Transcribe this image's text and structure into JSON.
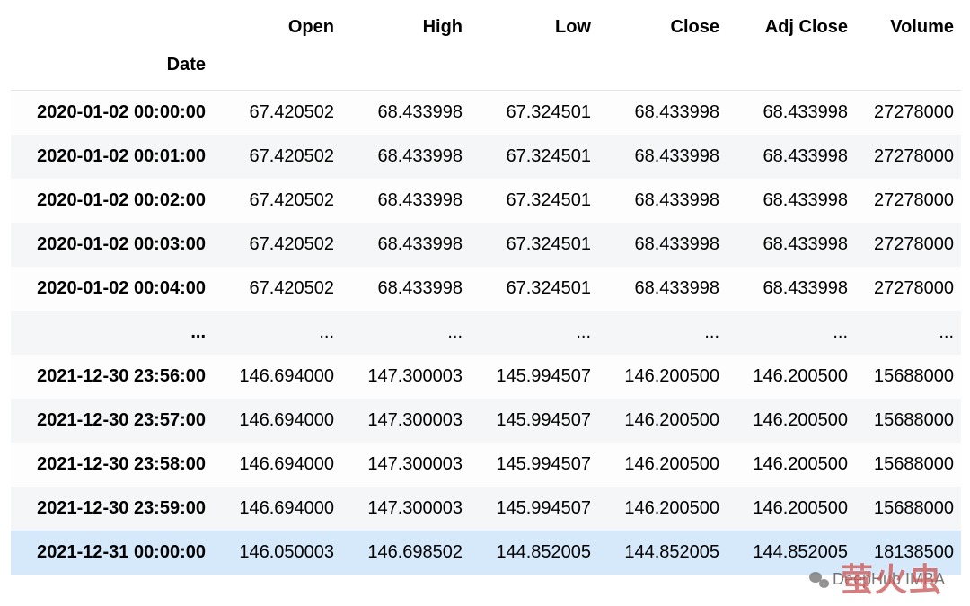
{
  "table": {
    "index_label": "Date",
    "columns": [
      "Open",
      "High",
      "Low",
      "Close",
      "Adj Close",
      "Volume"
    ],
    "ellipsis": "...",
    "rows": [
      {
        "date": "2020-01-02 00:00:00",
        "open": "67.420502",
        "high": "68.433998",
        "low": "67.324501",
        "close": "68.433998",
        "adj": "68.433998",
        "vol": "27278000",
        "hl": false
      },
      {
        "date": "2020-01-02 00:01:00",
        "open": "67.420502",
        "high": "68.433998",
        "low": "67.324501",
        "close": "68.433998",
        "adj": "68.433998",
        "vol": "27278000",
        "hl": false
      },
      {
        "date": "2020-01-02 00:02:00",
        "open": "67.420502",
        "high": "68.433998",
        "low": "67.324501",
        "close": "68.433998",
        "adj": "68.433998",
        "vol": "27278000",
        "hl": false
      },
      {
        "date": "2020-01-02 00:03:00",
        "open": "67.420502",
        "high": "68.433998",
        "low": "67.324501",
        "close": "68.433998",
        "adj": "68.433998",
        "vol": "27278000",
        "hl": false
      },
      {
        "date": "2020-01-02 00:04:00",
        "open": "67.420502",
        "high": "68.433998",
        "low": "67.324501",
        "close": "68.433998",
        "adj": "68.433998",
        "vol": "27278000",
        "hl": false
      },
      {
        "ellipsis": true
      },
      {
        "date": "2021-12-30 23:56:00",
        "open": "146.694000",
        "high": "147.300003",
        "low": "145.994507",
        "close": "146.200500",
        "adj": "146.200500",
        "vol": "15688000",
        "hl": false
      },
      {
        "date": "2021-12-30 23:57:00",
        "open": "146.694000",
        "high": "147.300003",
        "low": "145.994507",
        "close": "146.200500",
        "adj": "146.200500",
        "vol": "15688000",
        "hl": false
      },
      {
        "date": "2021-12-30 23:58:00",
        "open": "146.694000",
        "high": "147.300003",
        "low": "145.994507",
        "close": "146.200500",
        "adj": "146.200500",
        "vol": "15688000",
        "hl": false
      },
      {
        "date": "2021-12-30 23:59:00",
        "open": "146.694000",
        "high": "147.300003",
        "low": "145.994507",
        "close": "146.200500",
        "adj": "146.200500",
        "vol": "15688000",
        "hl": false
      },
      {
        "date": "2021-12-31 00:00:00",
        "open": "146.050003",
        "high": "146.698502",
        "low": "144.852005",
        "close": "144.852005",
        "adj": "144.852005",
        "vol": "18138500",
        "hl": true
      }
    ]
  },
  "watermark": {
    "line1": "DeepHub IMBA",
    "line2": "萤火虫"
  }
}
